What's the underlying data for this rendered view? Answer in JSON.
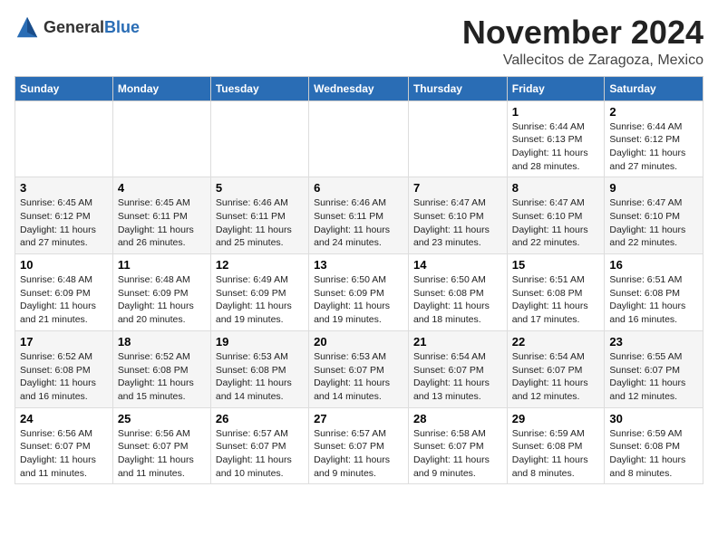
{
  "logo": {
    "general": "General",
    "blue": "Blue"
  },
  "header": {
    "month": "November 2024",
    "location": "Vallecitos de Zaragoza, Mexico"
  },
  "weekdays": [
    "Sunday",
    "Monday",
    "Tuesday",
    "Wednesday",
    "Thursday",
    "Friday",
    "Saturday"
  ],
  "weeks": [
    [
      {
        "day": "",
        "sunrise": "",
        "sunset": "",
        "daylight": ""
      },
      {
        "day": "",
        "sunrise": "",
        "sunset": "",
        "daylight": ""
      },
      {
        "day": "",
        "sunrise": "",
        "sunset": "",
        "daylight": ""
      },
      {
        "day": "",
        "sunrise": "",
        "sunset": "",
        "daylight": ""
      },
      {
        "day": "",
        "sunrise": "",
        "sunset": "",
        "daylight": ""
      },
      {
        "day": "1",
        "sunrise": "Sunrise: 6:44 AM",
        "sunset": "Sunset: 6:13 PM",
        "daylight": "Daylight: 11 hours and 28 minutes."
      },
      {
        "day": "2",
        "sunrise": "Sunrise: 6:44 AM",
        "sunset": "Sunset: 6:12 PM",
        "daylight": "Daylight: 11 hours and 27 minutes."
      }
    ],
    [
      {
        "day": "3",
        "sunrise": "Sunrise: 6:45 AM",
        "sunset": "Sunset: 6:12 PM",
        "daylight": "Daylight: 11 hours and 27 minutes."
      },
      {
        "day": "4",
        "sunrise": "Sunrise: 6:45 AM",
        "sunset": "Sunset: 6:11 PM",
        "daylight": "Daylight: 11 hours and 26 minutes."
      },
      {
        "day": "5",
        "sunrise": "Sunrise: 6:46 AM",
        "sunset": "Sunset: 6:11 PM",
        "daylight": "Daylight: 11 hours and 25 minutes."
      },
      {
        "day": "6",
        "sunrise": "Sunrise: 6:46 AM",
        "sunset": "Sunset: 6:11 PM",
        "daylight": "Daylight: 11 hours and 24 minutes."
      },
      {
        "day": "7",
        "sunrise": "Sunrise: 6:47 AM",
        "sunset": "Sunset: 6:10 PM",
        "daylight": "Daylight: 11 hours and 23 minutes."
      },
      {
        "day": "8",
        "sunrise": "Sunrise: 6:47 AM",
        "sunset": "Sunset: 6:10 PM",
        "daylight": "Daylight: 11 hours and 22 minutes."
      },
      {
        "day": "9",
        "sunrise": "Sunrise: 6:47 AM",
        "sunset": "Sunset: 6:10 PM",
        "daylight": "Daylight: 11 hours and 22 minutes."
      }
    ],
    [
      {
        "day": "10",
        "sunrise": "Sunrise: 6:48 AM",
        "sunset": "Sunset: 6:09 PM",
        "daylight": "Daylight: 11 hours and 21 minutes."
      },
      {
        "day": "11",
        "sunrise": "Sunrise: 6:48 AM",
        "sunset": "Sunset: 6:09 PM",
        "daylight": "Daylight: 11 hours and 20 minutes."
      },
      {
        "day": "12",
        "sunrise": "Sunrise: 6:49 AM",
        "sunset": "Sunset: 6:09 PM",
        "daylight": "Daylight: 11 hours and 19 minutes."
      },
      {
        "day": "13",
        "sunrise": "Sunrise: 6:50 AM",
        "sunset": "Sunset: 6:09 PM",
        "daylight": "Daylight: 11 hours and 19 minutes."
      },
      {
        "day": "14",
        "sunrise": "Sunrise: 6:50 AM",
        "sunset": "Sunset: 6:08 PM",
        "daylight": "Daylight: 11 hours and 18 minutes."
      },
      {
        "day": "15",
        "sunrise": "Sunrise: 6:51 AM",
        "sunset": "Sunset: 6:08 PM",
        "daylight": "Daylight: 11 hours and 17 minutes."
      },
      {
        "day": "16",
        "sunrise": "Sunrise: 6:51 AM",
        "sunset": "Sunset: 6:08 PM",
        "daylight": "Daylight: 11 hours and 16 minutes."
      }
    ],
    [
      {
        "day": "17",
        "sunrise": "Sunrise: 6:52 AM",
        "sunset": "Sunset: 6:08 PM",
        "daylight": "Daylight: 11 hours and 16 minutes."
      },
      {
        "day": "18",
        "sunrise": "Sunrise: 6:52 AM",
        "sunset": "Sunset: 6:08 PM",
        "daylight": "Daylight: 11 hours and 15 minutes."
      },
      {
        "day": "19",
        "sunrise": "Sunrise: 6:53 AM",
        "sunset": "Sunset: 6:08 PM",
        "daylight": "Daylight: 11 hours and 14 minutes."
      },
      {
        "day": "20",
        "sunrise": "Sunrise: 6:53 AM",
        "sunset": "Sunset: 6:07 PM",
        "daylight": "Daylight: 11 hours and 14 minutes."
      },
      {
        "day": "21",
        "sunrise": "Sunrise: 6:54 AM",
        "sunset": "Sunset: 6:07 PM",
        "daylight": "Daylight: 11 hours and 13 minutes."
      },
      {
        "day": "22",
        "sunrise": "Sunrise: 6:54 AM",
        "sunset": "Sunset: 6:07 PM",
        "daylight": "Daylight: 11 hours and 12 minutes."
      },
      {
        "day": "23",
        "sunrise": "Sunrise: 6:55 AM",
        "sunset": "Sunset: 6:07 PM",
        "daylight": "Daylight: 11 hours and 12 minutes."
      }
    ],
    [
      {
        "day": "24",
        "sunrise": "Sunrise: 6:56 AM",
        "sunset": "Sunset: 6:07 PM",
        "daylight": "Daylight: 11 hours and 11 minutes."
      },
      {
        "day": "25",
        "sunrise": "Sunrise: 6:56 AM",
        "sunset": "Sunset: 6:07 PM",
        "daylight": "Daylight: 11 hours and 11 minutes."
      },
      {
        "day": "26",
        "sunrise": "Sunrise: 6:57 AM",
        "sunset": "Sunset: 6:07 PM",
        "daylight": "Daylight: 11 hours and 10 minutes."
      },
      {
        "day": "27",
        "sunrise": "Sunrise: 6:57 AM",
        "sunset": "Sunset: 6:07 PM",
        "daylight": "Daylight: 11 hours and 9 minutes."
      },
      {
        "day": "28",
        "sunrise": "Sunrise: 6:58 AM",
        "sunset": "Sunset: 6:07 PM",
        "daylight": "Daylight: 11 hours and 9 minutes."
      },
      {
        "day": "29",
        "sunrise": "Sunrise: 6:59 AM",
        "sunset": "Sunset: 6:08 PM",
        "daylight": "Daylight: 11 hours and 8 minutes."
      },
      {
        "day": "30",
        "sunrise": "Sunrise: 6:59 AM",
        "sunset": "Sunset: 6:08 PM",
        "daylight": "Daylight: 11 hours and 8 minutes."
      }
    ]
  ]
}
